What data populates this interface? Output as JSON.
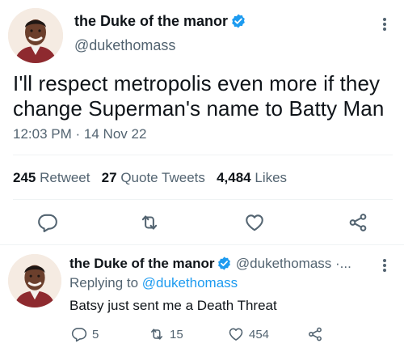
{
  "main_tweet": {
    "display_name": "the Duke of the manor",
    "handle": "@dukethomass",
    "text_line1": "I'll respect metropolis even more if they",
    "text_line2": "change Superman's name to Batty Man",
    "time": "12:03 PM",
    "date_sep": "·",
    "date": "14 Nov 22",
    "retweets_count": "245",
    "retweets_label": "Retweet",
    "quotes_count": "27",
    "quotes_label": "Quote Tweets",
    "likes_count": "4,484",
    "likes_label": "Likes"
  },
  "reply_tweet": {
    "display_name": "the Duke of the manor",
    "handle": "@dukethomass ·...",
    "replying_prefix": "Replying to",
    "replying_to": "@dukethomass",
    "text": "Batsy just sent me a Death Threat",
    "replies_count": "5",
    "retweets_count": "15",
    "likes_count": "454"
  },
  "colors": {
    "accent": "#1d9bf0",
    "secondary_text": "#536471",
    "divider": "#eff3f4"
  },
  "icons": [
    "verified-badge-icon",
    "more-icon",
    "reply-icon",
    "retweet-icon",
    "like-icon",
    "share-icon"
  ]
}
